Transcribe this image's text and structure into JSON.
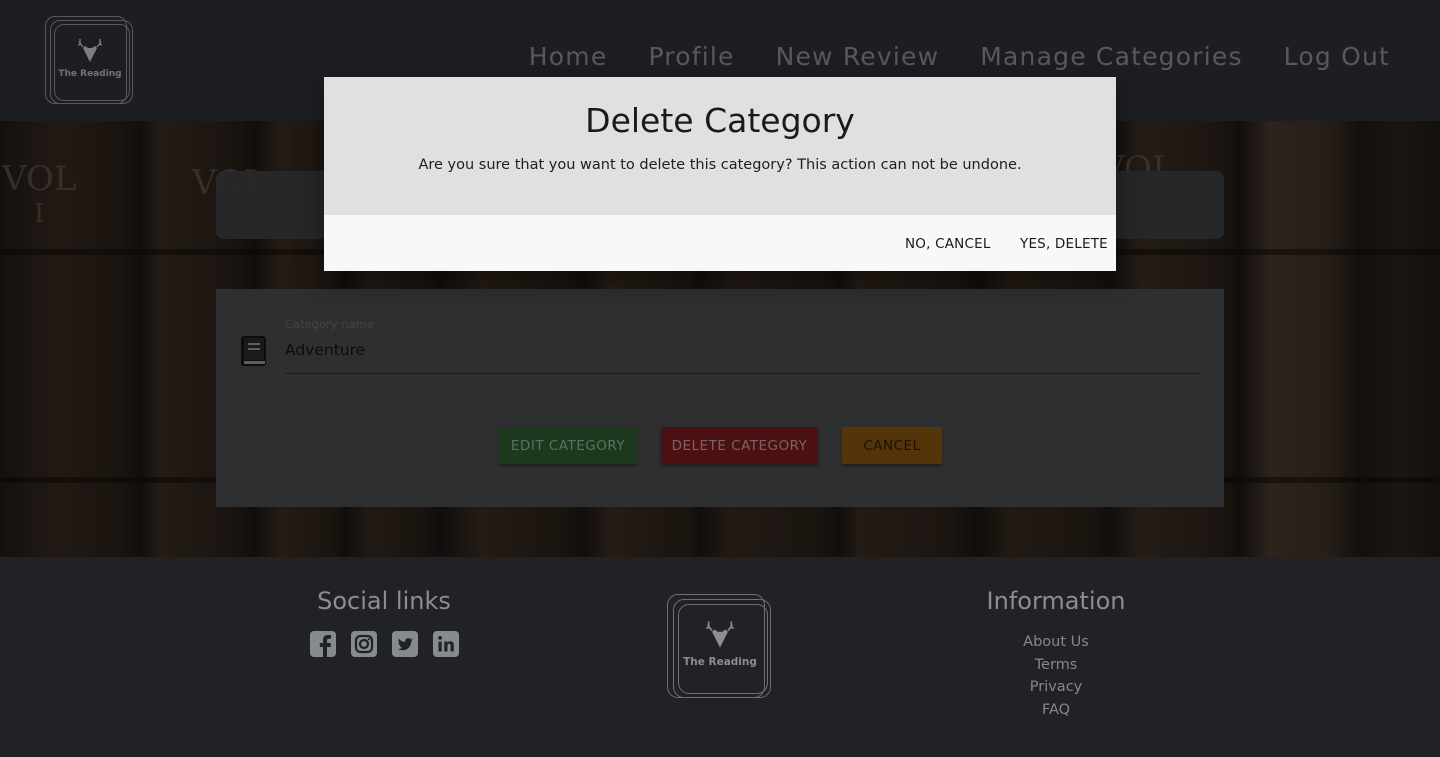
{
  "header": {
    "logo_text": "The Reading",
    "nav": [
      "Home",
      "Profile",
      "New Review",
      "Manage Categories",
      "Log Out"
    ]
  },
  "background": {
    "book_marks": [
      "VOL",
      "I",
      "VOL",
      "VOL"
    ]
  },
  "form": {
    "field_label": "Category name",
    "field_value": "Adventure",
    "edit_button": "EDIT CATEGORY",
    "delete_button": "DELETE CATEGORY",
    "cancel_button": "CANCEL"
  },
  "modal": {
    "title": "Delete Category",
    "message": "Are you sure that you want to delete this category? This action can not be undone.",
    "cancel_label": "NO, CANCEL",
    "confirm_label": "YES, DELETE"
  },
  "footer": {
    "social_title": "Social links",
    "social_icons": [
      "facebook-icon",
      "instagram-icon",
      "twitter-icon",
      "linkedin-icon"
    ],
    "logo_text": "The Reading",
    "info_title": "Information",
    "info_links": [
      "About Us",
      "Terms",
      "Privacy",
      "FAQ"
    ]
  },
  "colors": {
    "edit": "#43a047",
    "delete": "#e53935",
    "cancel": "#f57c00"
  }
}
